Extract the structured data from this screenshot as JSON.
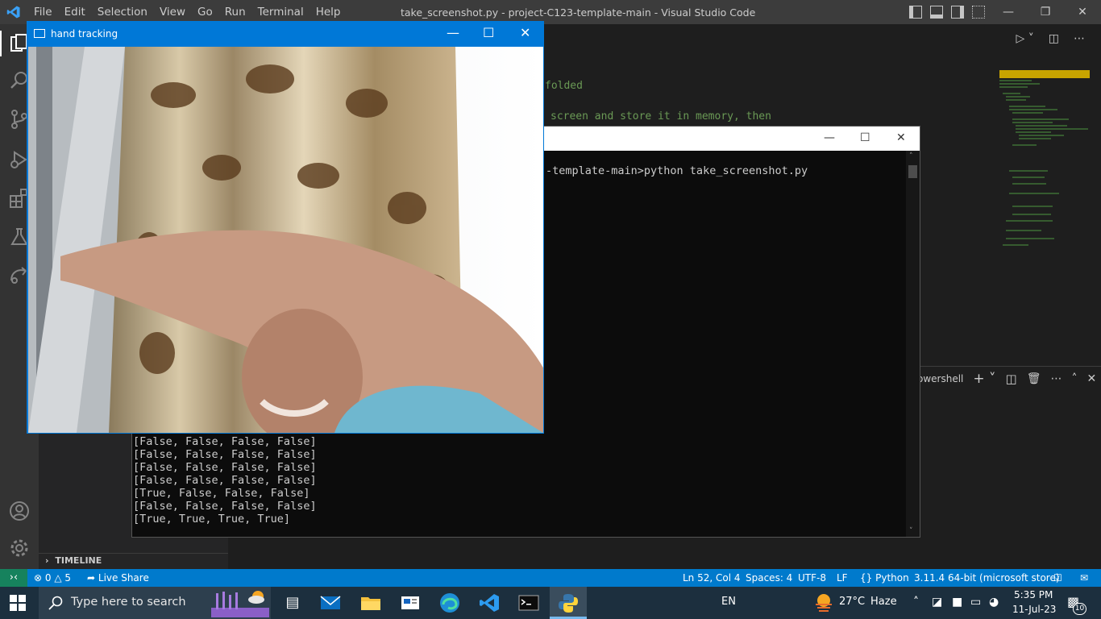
{
  "vscode": {
    "menu": [
      "File",
      "Edit",
      "Selection",
      "View",
      "Go",
      "Run",
      "Terminal",
      "Help"
    ],
    "window_title": "take_screenshot.py - project-C123-template-main - Visual Studio Code",
    "code_lines": [
      "folded",
      "screen and store it in memory, then"
    ],
    "timeline_label": "TIMELINE",
    "panel_shell": "owershell"
  },
  "console": {
    "command_line": "-template-main>python take_screenshot.py",
    "output": [
      "[False, False, False, False]",
      "[False, False, False, False]",
      "[False, False, False, False]",
      "[False, False, False, False]",
      "[True, False, False, False]",
      "[False, False, False, False]",
      "[True, True, True, True]"
    ]
  },
  "hand_window": {
    "title": "hand tracking"
  },
  "statusbar": {
    "errors": "0",
    "warnings": "5",
    "live_share": "Live Share",
    "position": "Ln 52, Col 4",
    "spaces": "Spaces: 4",
    "encoding": "UTF-8",
    "eol": "LF",
    "language": "Python",
    "interpreter": "3.11.4 64-bit (microsoft store)"
  },
  "taskbar": {
    "search_placeholder": "Type here to search",
    "language": "EN",
    "temperature": "27°C",
    "weather": "Haze",
    "time": "5:35 PM",
    "date": "11-Jul-23",
    "notification_count": "10"
  },
  "colors": {
    "titlebar": "#3c3c3c",
    "activitybar": "#333333",
    "statusbar": "#007acc",
    "remote": "#16825d",
    "hand_window_accent": "#0078d7",
    "taskbar": "#1c2f3e"
  }
}
